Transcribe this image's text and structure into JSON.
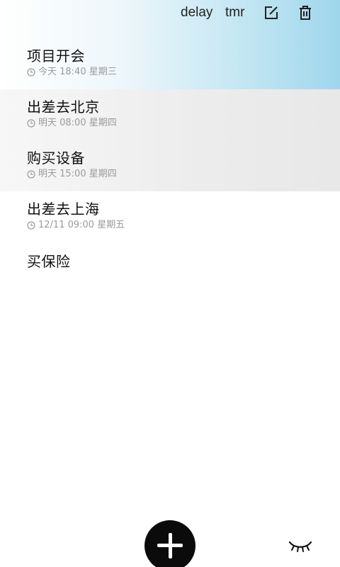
{
  "toolbar": {
    "delay_label": "delay",
    "tmr_label": "tmr",
    "edit_icon": "edit-icon",
    "delete_icon": "trash-icon"
  },
  "tasks": [
    {
      "title": "项目开会",
      "time": "今天 18:40 星期三"
    },
    {
      "title": "出差去北京",
      "time": "明天 08:00 星期四"
    },
    {
      "title": "购买设备",
      "time": "明天 15:00 星期四"
    },
    {
      "title": "出差去上海",
      "time": "12/11 09:00 星期五"
    },
    {
      "title": "买保险",
      "time": ""
    }
  ],
  "actions": {
    "add_icon": "plus-icon",
    "visibility_icon": "closed-eye-icon"
  },
  "colors": {
    "accent_gradient_end": "#9fd6ec",
    "fab_background": "#0b0b0b",
    "meta_text": "#9a9a9a"
  }
}
